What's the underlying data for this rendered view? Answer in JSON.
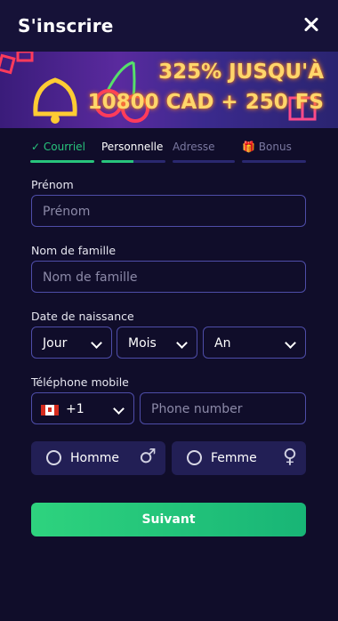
{
  "header": {
    "title": "S'inscrire"
  },
  "banner": {
    "line1": "325% JUSQU'À",
    "line2": "10800 CAD + 250 FS"
  },
  "steps": [
    {
      "label": "✓ Courriel",
      "state": "done"
    },
    {
      "label": "Personnelle",
      "state": "active"
    },
    {
      "label": "Adresse",
      "state": "pending"
    },
    {
      "label": "Bonus",
      "state": "pending",
      "icon": "gift-icon"
    }
  ],
  "form": {
    "first_name": {
      "label": "Prénom",
      "placeholder": "Prénom"
    },
    "last_name": {
      "label": "Nom de famille",
      "placeholder": "Nom de famille"
    },
    "birth": {
      "label": "Date de naissance",
      "day": "Jour",
      "month": "Mois",
      "year": "An"
    },
    "phone": {
      "label": "Téléphone mobile",
      "country_code": "+1",
      "flag": "canada-flag-icon",
      "placeholder": "Phone number"
    },
    "gender": {
      "male": "Homme",
      "female": "Femme"
    },
    "submit": "Suivant"
  },
  "colors": {
    "background": "#100d2a",
    "accent": "#28c47c",
    "field_border": "#4e4da8"
  }
}
